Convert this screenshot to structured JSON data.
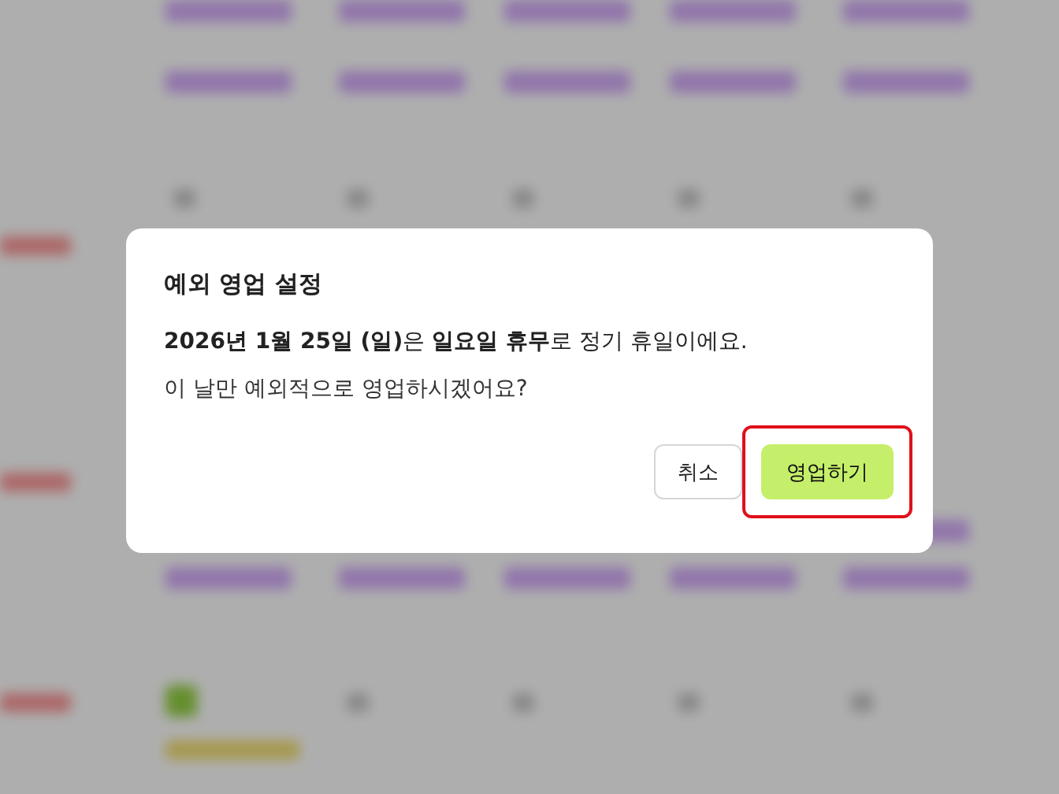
{
  "dialog": {
    "title": "예외 영업 설정",
    "message": "**2026년 1월 25일 (일)**은 **일요일 휴무**로 정기 휴일이에요.",
    "question": "이 날만 예외적으로 영업하시겠어요?",
    "buttons": [
      {
        "label": "취소",
        "kind": "secondary",
        "highlighted": false
      },
      {
        "label": "영업하기",
        "kind": "primary",
        "highlighted": true
      }
    ]
  }
}
